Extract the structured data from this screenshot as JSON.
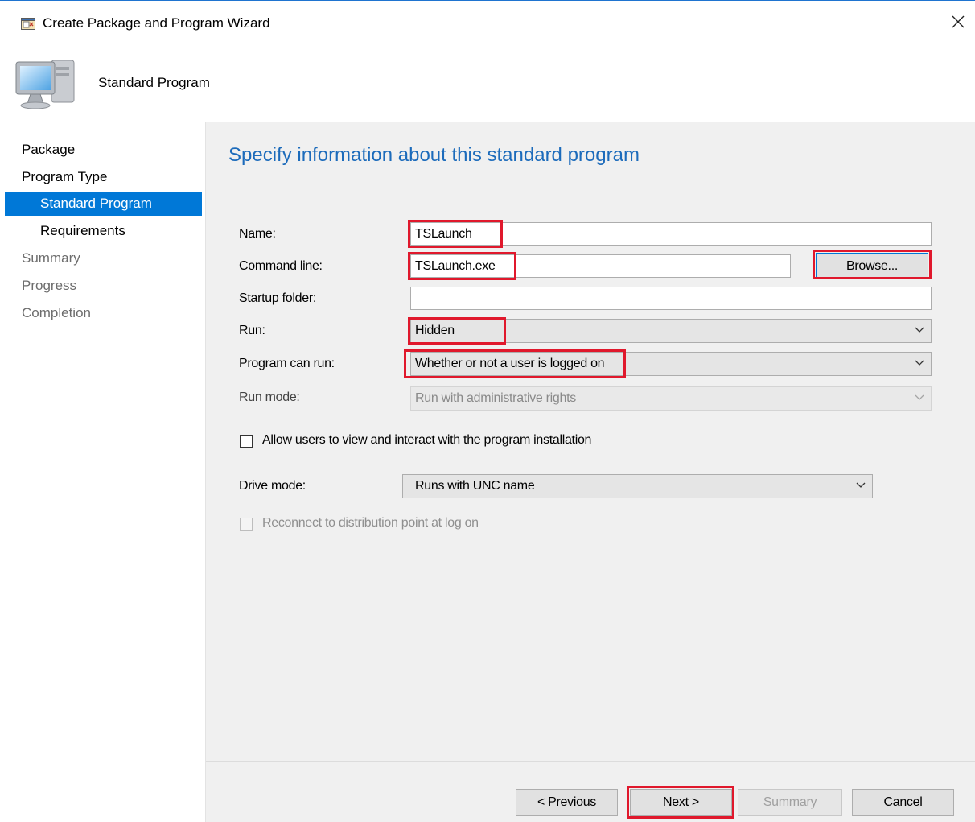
{
  "window": {
    "title": "Create Package and Program Wizard"
  },
  "header": {
    "title": "Standard Program"
  },
  "sidebar": {
    "items": [
      {
        "label": "Package"
      },
      {
        "label": "Program Type"
      },
      {
        "label": "Standard Program"
      },
      {
        "label": "Requirements"
      },
      {
        "label": "Summary"
      },
      {
        "label": "Progress"
      },
      {
        "label": "Completion"
      }
    ]
  },
  "main": {
    "heading": "Specify information about this standard program",
    "name_label": "Name:",
    "name_value": "TSLaunch",
    "command_label": "Command line:",
    "command_value": "TSLaunch.exe",
    "browse_label": "Browse...",
    "startup_label": "Startup folder:",
    "startup_value": "",
    "run_label": "Run:",
    "run_value": "Hidden",
    "program_can_run_label": "Program can run:",
    "program_can_run_value": "Whether or not a user is logged on",
    "run_mode_label": "Run mode:",
    "run_mode_value": "Run with administrative rights",
    "allow_users_label": "Allow users to view and interact with the program installation",
    "drive_mode_label": "Drive mode:",
    "drive_mode_value": "Runs with UNC name",
    "reconnect_label": "Reconnect to distribution point at log on"
  },
  "footer": {
    "previous": "< Previous",
    "next": "Next >",
    "summary": "Summary",
    "cancel": "Cancel"
  },
  "colors": {
    "accent": "#0078d7",
    "heading": "#1c6bbb",
    "highlight": "#e0182c"
  },
  "icons": [
    "wizard-app-icon",
    "close-icon",
    "computer-icon",
    "chevron-down-icon"
  ]
}
